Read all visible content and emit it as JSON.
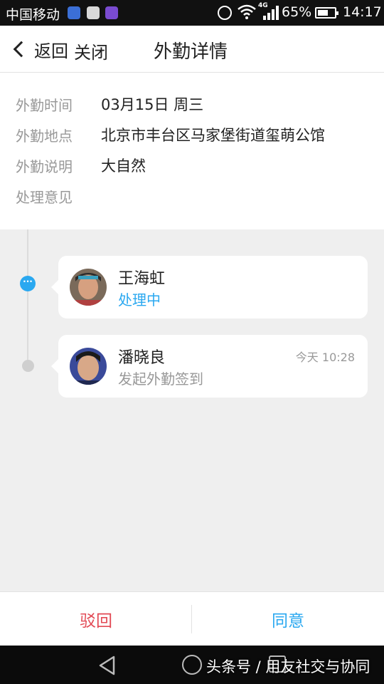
{
  "status_bar": {
    "carrier": "中国移动",
    "network": "4G",
    "battery": "65%",
    "battery_level": 0.65,
    "time": "14:17"
  },
  "header": {
    "back_label": "返回",
    "close_label": "关闭",
    "title": "外勤详情"
  },
  "details": [
    {
      "key": "外勤时间",
      "value": "03月15日 周三"
    },
    {
      "key": "外勤地点",
      "value": "北京市丰台区马家堡街道玺萌公馆"
    },
    {
      "key": "外勤说明",
      "value": "大自然"
    },
    {
      "key": "处理意见",
      "value": ""
    }
  ],
  "timeline": [
    {
      "name": "王海虹",
      "status": "处理中",
      "time": "",
      "status_color": "#2aa8f0",
      "indicator": "···"
    },
    {
      "name": "潘晓良",
      "status": "发起外勤签到",
      "time": "今天 10:28",
      "status_color": "#999999",
      "indicator": ""
    }
  ],
  "actions": {
    "reject_label": "驳回",
    "agree_label": "同意",
    "reject_color": "#e24a55",
    "agree_color": "#2aa8f0"
  },
  "watermark": "头条号 / 用友社交与协同"
}
